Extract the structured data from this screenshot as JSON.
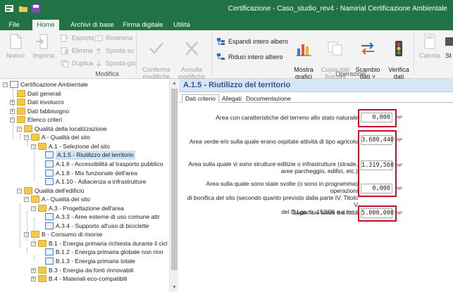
{
  "window": {
    "title": "Certificazione - Caso_studio_rev4 - Namirial Certificazione Ambientale"
  },
  "quick_access": [
    "app-icon",
    "open-folder-icon",
    "save-icon"
  ],
  "colors": {
    "accent": "#217346",
    "highlight_red": "#c8102e",
    "selection": "#cce3f5",
    "header_blue": "#2b5797"
  },
  "ribbon_tabs": [
    {
      "label": "File",
      "active": false
    },
    {
      "label": "Home",
      "active": true
    },
    {
      "label": "Archivi di base",
      "active": false
    },
    {
      "label": "Firma digitale",
      "active": false
    },
    {
      "label": "Utilità",
      "active": false
    }
  ],
  "ribbon": {
    "nuovo": "Nuovo",
    "importa": "Importa",
    "esporta": "Esporta",
    "elimina": "Elimina",
    "duplica": "Duplica",
    "rinomina": "Rinomina",
    "sposta_su": "Sposta su",
    "sposta_giu": "Sposta giù",
    "modifica_group": "Modifica",
    "conferma": "Conferma\nmodifiche",
    "annulla": "Annulla\nmodifiche",
    "espandi": "Espandi intero albero",
    "riduci": "Riduci intero albero",
    "mostra_grafici": "Mostra\ngrafici",
    "copia_dati": "Copia dati\nfinestra",
    "scambio_dati": "Scambio\ndati ˅",
    "verifica_dati": "Verifica\ndati",
    "operazioni_group": "Operazioni",
    "calcola": "Calcola",
    "st": "St"
  },
  "tree": [
    {
      "label": "Certificazione Ambientale",
      "icon": "book-icon",
      "expander": "−"
    },
    {
      "label": "Dati generali",
      "icon": "folder-icon",
      "expander": ""
    },
    {
      "label": "Dati involucro",
      "icon": "folder-icon",
      "expander": "+"
    },
    {
      "label": "Dati fabbisogno",
      "icon": "folder-icon",
      "expander": "+"
    },
    {
      "label": "Elenco criteri",
      "icon": "folder-icon",
      "expander": "−"
    },
    {
      "label": "Qualità della localizzazione",
      "icon": "folder-icon",
      "expander": "−"
    },
    {
      "label": "A - Qualità del sito",
      "icon": "folder-icon",
      "expander": "−"
    },
    {
      "label": "A.1 - Selezione del sito",
      "icon": "folder-icon",
      "expander": "−"
    },
    {
      "label": "A.1.5 - Riutilizzo del territorio",
      "icon": "edit-doc-icon",
      "expander": "",
      "selected": true
    },
    {
      "label": "A.1.6 - Accessibilità al trasporto pubblico",
      "icon": "edit-doc-icon",
      "expander": ""
    },
    {
      "label": "A.1.8 - Mix funzionale dell'area",
      "icon": "edit-doc-icon",
      "expander": ""
    },
    {
      "label": "A.1.10 - Adiacenza a infrastrutture",
      "icon": "edit-doc-icon",
      "expander": ""
    },
    {
      "label": "Qualità dell'edificio",
      "icon": "folder-icon",
      "expander": "−"
    },
    {
      "label": "A - Qualità del sito",
      "icon": "folder-icon",
      "expander": "−"
    },
    {
      "label": "A.3 - Progettazione dell'area",
      "icon": "folder-icon",
      "expander": "−"
    },
    {
      "label": "A.3.3 - Aree esterne di uso comune attr",
      "icon": "edit-doc-icon",
      "expander": ""
    },
    {
      "label": "A.3.4 - Supporto all'uso di biciclette",
      "icon": "edit-doc-icon",
      "expander": ""
    },
    {
      "label": "B - Consumo di risorse",
      "icon": "folder-icon",
      "expander": "−"
    },
    {
      "label": "B.1 - Energia primaria richiesta durante il cicl",
      "icon": "folder-icon",
      "expander": "−"
    },
    {
      "label": "B.1.2 - Energia primaria globale non rinn",
      "icon": "edit-doc-icon",
      "expander": ""
    },
    {
      "label": "B.1.3 - Energia primaria totale",
      "icon": "edit-doc-icon",
      "expander": ""
    },
    {
      "label": "B.3 - Energia da fonti rinnovabili",
      "icon": "folder-icon",
      "expander": "+"
    },
    {
      "label": "B.4 - Materiali eco-compatibili",
      "icon": "folder-icon",
      "expander": "+"
    }
  ],
  "panel": {
    "title": "A.1.5 - Riutilizzo del territorio",
    "tabs": [
      {
        "label": "Dati criterio",
        "active": true
      },
      {
        "label": "Allegati",
        "active": false
      },
      {
        "label": "Documentazione",
        "active": false
      }
    ],
    "fields": [
      {
        "label": "Area con caratteristiche del terreno allo stato naturale",
        "value": "0,000",
        "unit": "m²"
      },
      {
        "label": "Area verde e/o sulla quale erano ospitate attività di tipo agricolo",
        "value": "3.680,440",
        "unit": "m²"
      },
      {
        "label": "Area sulla quale vi sono strutture edilizie o infrastrutture (strade,\naree parcheggio, edifici, etc.)",
        "value": "1.319,560",
        "unit": "m²"
      },
      {
        "label": "Area sulla quale sono state svolte (o sono in programma) operazioni\ndi bonifica del sito (secondo quanto previsto dalla parte IV, Titolo V\ndel D.Lgs. n. 152/06 e s.m.i.)",
        "value": "0,000",
        "unit": "m²"
      },
      {
        "label": "Superficie totale del lotto",
        "value": "5.000,000",
        "unit": "m²"
      }
    ]
  }
}
